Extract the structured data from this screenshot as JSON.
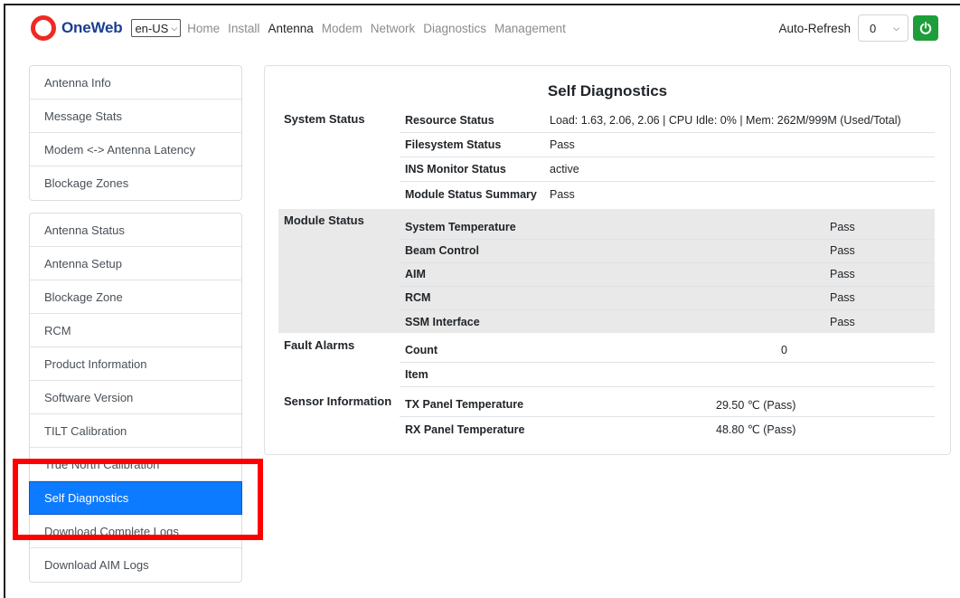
{
  "brand": {
    "name": "OneWeb",
    "ring_color": "#ee2a24",
    "text_color": "#1b3e8f"
  },
  "language": {
    "selected": "en-US"
  },
  "nav": {
    "items": [
      {
        "label": "Home",
        "active": false
      },
      {
        "label": "Install",
        "active": false
      },
      {
        "label": "Antenna",
        "active": true
      },
      {
        "label": "Modem",
        "active": false
      },
      {
        "label": "Network",
        "active": false
      },
      {
        "label": "Diagnostics",
        "active": false
      },
      {
        "label": "Management",
        "active": false
      }
    ],
    "auto_refresh_label": "Auto-Refresh",
    "auto_refresh_value": "0",
    "power_icon": "power-icon",
    "power_color": "#1e9e3a"
  },
  "sidebar": {
    "group1": [
      "Antenna Info",
      "Message Stats",
      "Modem <-> Antenna Latency",
      "Blockage Zones"
    ],
    "group2": [
      "Antenna Status",
      "Antenna Setup",
      "Blockage Zone",
      "RCM",
      "Product Information",
      "Software Version",
      "TILT Calibration",
      "True North Calibration",
      "Self Diagnostics",
      "Download Complete Logs",
      "Download AIM Logs"
    ],
    "active": "Self Diagnostics",
    "active_color": "#0d7bff",
    "highlight_color": "#ff0000"
  },
  "main": {
    "title": "Self Diagnostics",
    "system_status": {
      "label": "System Status",
      "rows": [
        {
          "key": "Resource Status",
          "value": "Load: 1.63, 2.06, 2.06 | CPU Idle: 0% | Mem: 262M/999M (Used/Total)"
        },
        {
          "key": "Filesystem Status",
          "value": "Pass"
        },
        {
          "key": "INS Monitor Status",
          "value": "active"
        },
        {
          "key": "Module Status Summary",
          "value": "Pass"
        }
      ]
    },
    "module_status": {
      "label": "Module Status",
      "rows": [
        {
          "key": "System Temperature",
          "value": "Pass"
        },
        {
          "key": "Beam Control",
          "value": "Pass"
        },
        {
          "key": "AIM",
          "value": "Pass"
        },
        {
          "key": "RCM",
          "value": "Pass"
        },
        {
          "key": "SSM Interface",
          "value": "Pass"
        }
      ]
    },
    "fault_alarms": {
      "label": "Fault Alarms",
      "rows": [
        {
          "key": "Count",
          "value": "0"
        },
        {
          "key": "Item",
          "value": ""
        }
      ]
    },
    "sensor_information": {
      "label": "Sensor Information",
      "rows": [
        {
          "key": "TX Panel Temperature",
          "value": "29.50 ℃ (Pass)"
        },
        {
          "key": "RX Panel Temperature",
          "value": "48.80 ℃ (Pass)"
        }
      ]
    }
  }
}
